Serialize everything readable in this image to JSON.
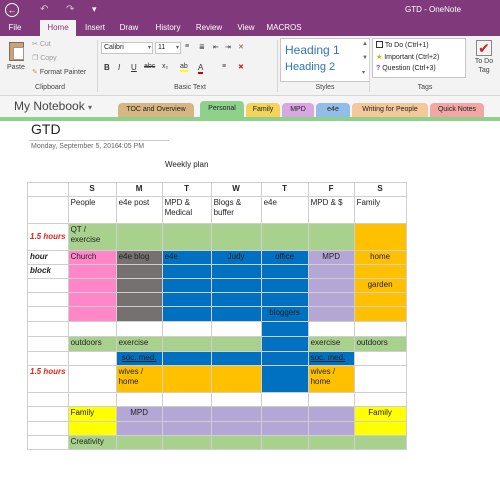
{
  "window": {
    "title": "GTD - OneNote"
  },
  "ribbon": {
    "tabs": [
      "File",
      "Home",
      "Insert",
      "Draw",
      "History",
      "Review",
      "View",
      "MACROS"
    ],
    "clipboard": {
      "paste": "Paste",
      "cut": "Cut",
      "copy": "Copy",
      "format_painter": "Format Painter",
      "group_label": "Clipboard"
    },
    "basic_text": {
      "font": "Calibri",
      "size": "11",
      "group_label": "Basic Text",
      "bold": "B",
      "italic": "I",
      "underline": "U",
      "strike": "abc",
      "subscript": "x₂",
      "font_color": "A",
      "highlight": "ab"
    },
    "styles": {
      "heading1": "Heading 1",
      "heading2": "Heading 2",
      "group_label": "Styles"
    },
    "tags": {
      "todo": "To Do (Ctrl+1)",
      "important": "Important (Ctrl+2)",
      "question": "Question (Ctrl+3)",
      "todo_tag_line1": "To Do",
      "todo_tag_line2": "Tag",
      "group_label": "Tags"
    },
    "colors": {
      "accent": "#80397b"
    }
  },
  "notebook": {
    "name": "My Notebook",
    "sections": [
      {
        "label": "TOC and Overview",
        "color": "#d8b682"
      },
      {
        "label": "Personal",
        "color": "#8dd18b"
      },
      {
        "label": "Family",
        "color": "#f3d35a"
      },
      {
        "label": "MPD",
        "color": "#d7a6e3"
      },
      {
        "label": "e4e",
        "color": "#91bde8"
      },
      {
        "label": "Writing for People",
        "color": "#f5c89a"
      },
      {
        "label": "Quick Notes",
        "color": "#f2a6a6"
      }
    ]
  },
  "page": {
    "title": "GTD",
    "date": "Monday, September 5, 2016",
    "time": "4:05 PM",
    "subtitle": "Weekly plan"
  },
  "schedule": {
    "days": [
      "S",
      "M",
      "T",
      "W",
      "T",
      "F",
      "S"
    ],
    "headers": [
      "People",
      "e4e post",
      "MPD &\nMedical",
      "Blogs &\nbuffer",
      "e4e",
      "MPD & $",
      "Family"
    ],
    "labels": {
      "hours1": "1.5 hours",
      "hour": "hour",
      "block": "block",
      "hours2": "1.5 hours"
    },
    "cells": {
      "qt": "QT /\nexercise",
      "church": "Church",
      "e4e_blog": "e4e blog",
      "e4e": "e4e",
      "judy": "Judy",
      "office": "office",
      "mpd": "MPD",
      "home": "home",
      "garden": "garden",
      "bloggers": "bloggers",
      "outdoors1": "outdoors",
      "exercise1": "exercise",
      "exercise2": "exercise",
      "outdoors2": "outdoors",
      "soc_med1": "soc. med.",
      "soc_med2": "soc. med.",
      "wives_home1": "wives /\nhome",
      "wives_home2": "wives /\nhome",
      "family1": "Family",
      "mpd2": "MPD",
      "family2": "Family",
      "creativity": "Creativity"
    }
  }
}
